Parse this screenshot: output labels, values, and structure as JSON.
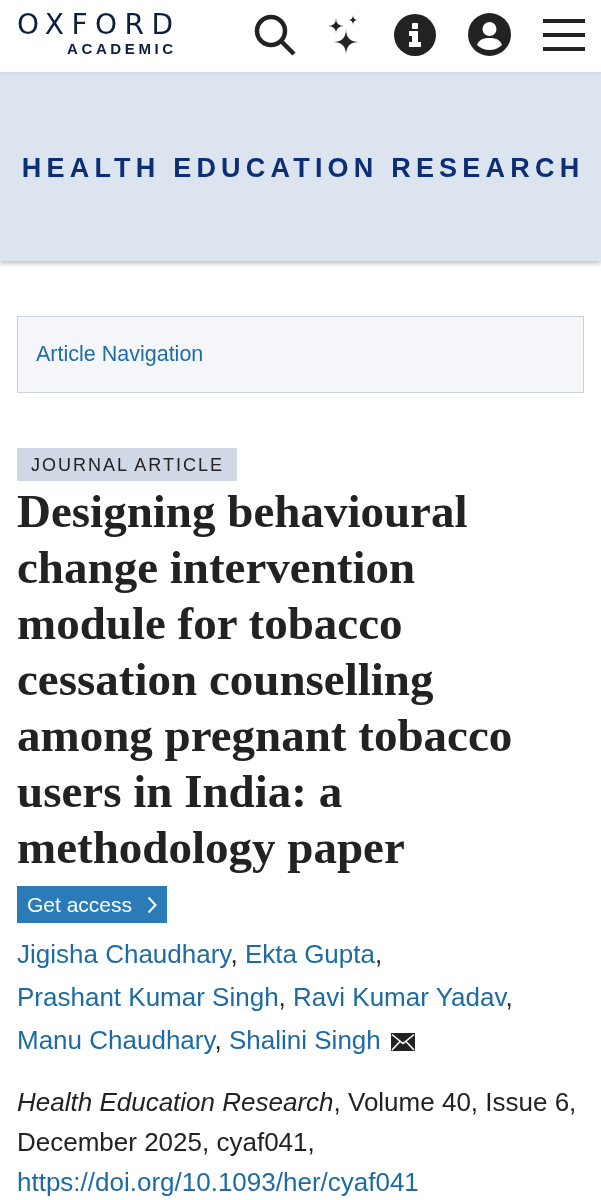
{
  "header": {
    "logo": {
      "wordmark": "OXFORD",
      "subtitle": "ACADEMIC"
    },
    "icons": [
      {
        "kind": "search"
      },
      {
        "kind": "sparkle"
      },
      {
        "kind": "info"
      },
      {
        "kind": "account"
      },
      {
        "kind": "menu"
      }
    ]
  },
  "journal_banner": {
    "title": "HEALTH EDUCATION RESEARCH"
  },
  "article_navigation": {
    "label": "Article Navigation"
  },
  "article": {
    "type_tag": "JOURNAL ARTICLE",
    "title": "Designing behavioural change intervention module for tobacco cessation counselling among pregnant tobacco users in India: a methodology paper",
    "access_button": {
      "label": "Get access"
    },
    "authors": [
      {
        "name": "Jigisha Chaudhary",
        "separator": ",",
        "corresponding": false
      },
      {
        "name": "Ekta Gupta",
        "separator": ",",
        "corresponding": false
      },
      {
        "name": "Prashant Kumar Singh",
        "separator": ",",
        "corresponding": false
      },
      {
        "name": "Ravi Kumar Yadav",
        "separator": ",",
        "corresponding": false
      },
      {
        "name": "Manu Chaudhary",
        "separator": ",",
        "corresponding": false
      },
      {
        "name": "Shalini Singh",
        "corresponding": true
      }
    ],
    "citation": {
      "text": "*Health Education Research*, Volume 40, Issue 6, December 2025, cyaf041,",
      "doi": "https://doi.org/10.1093/her/cyaf041"
    }
  }
}
